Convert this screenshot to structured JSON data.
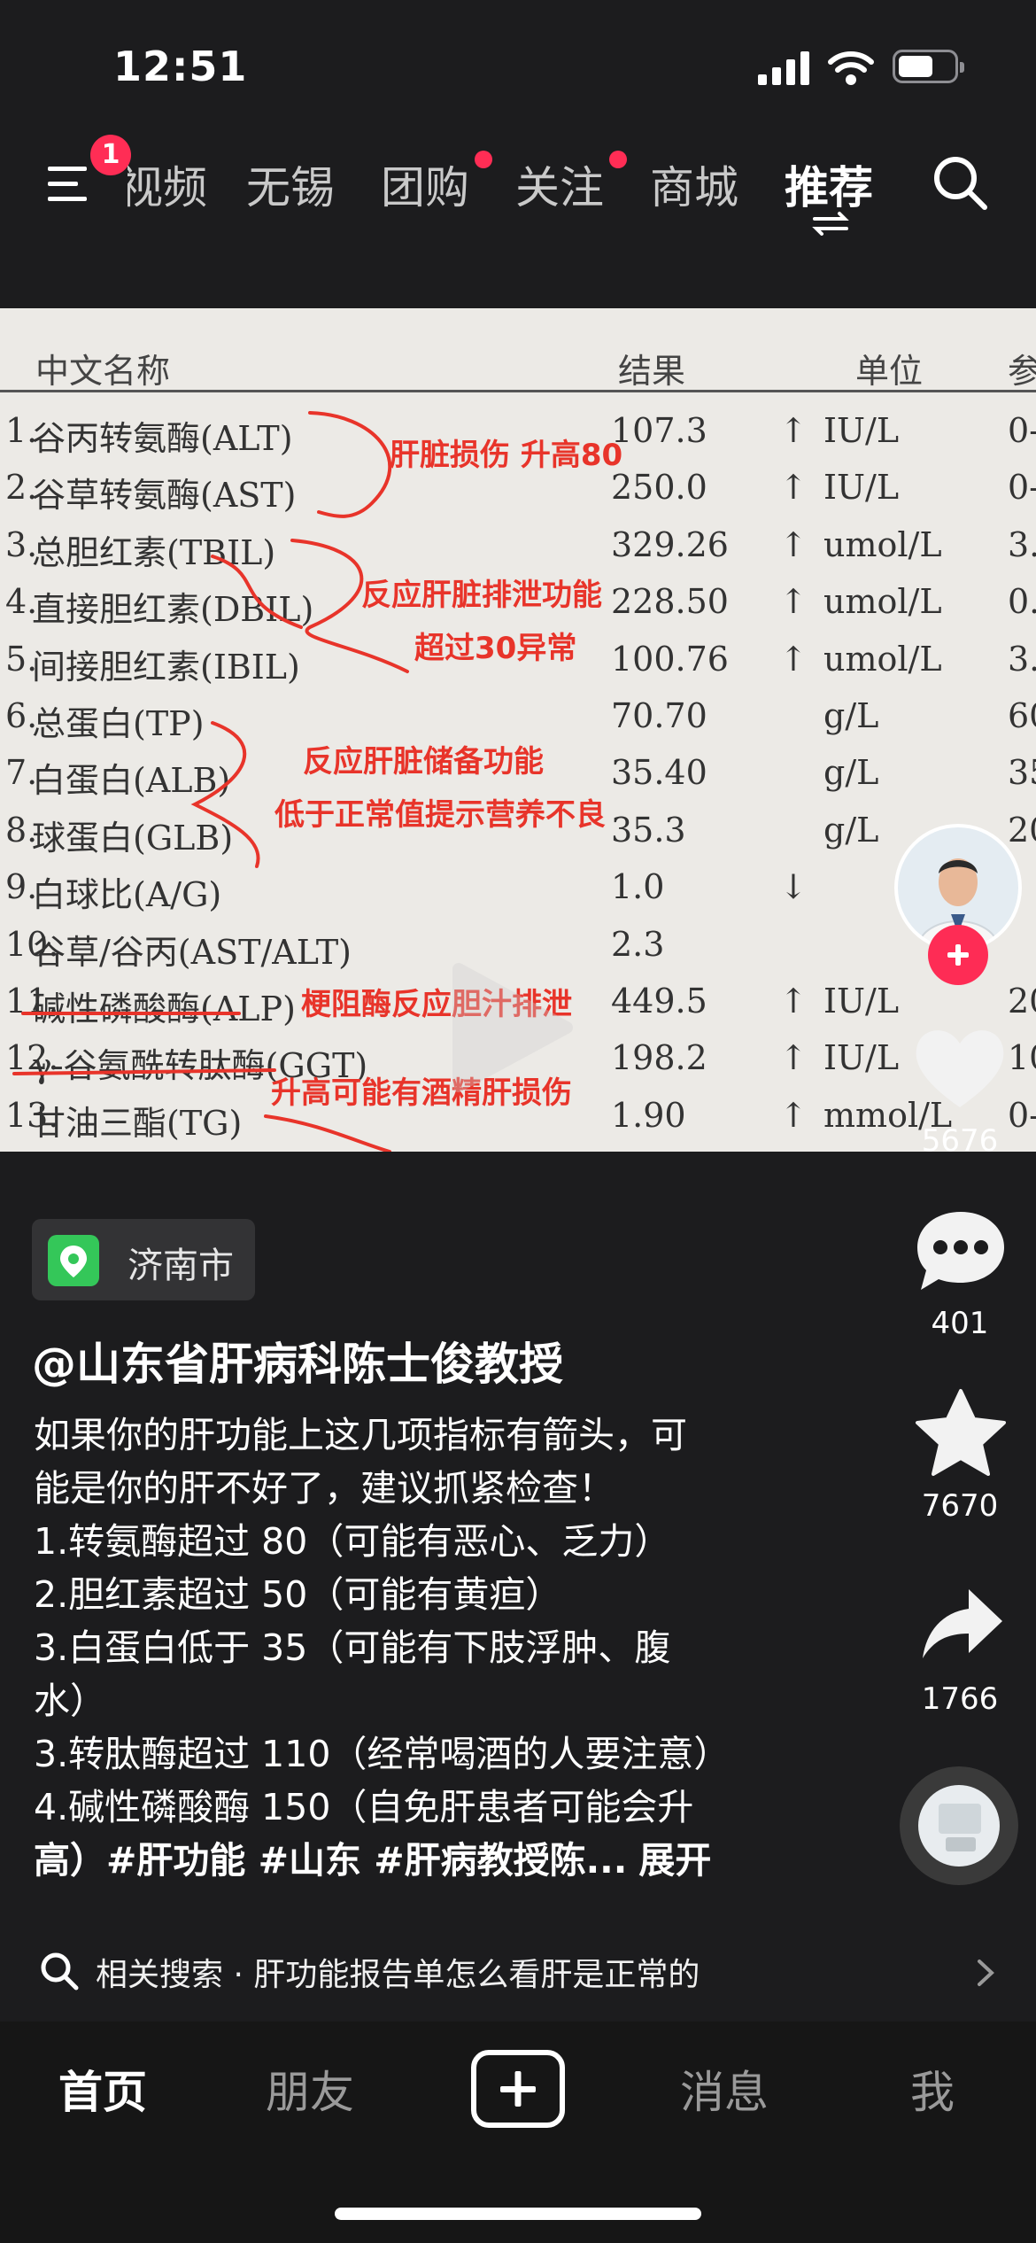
{
  "status": {
    "time": "12:51"
  },
  "top_nav": {
    "menu_badge": "1",
    "tabs": [
      {
        "label": "视频"
      },
      {
        "label": "无锡"
      },
      {
        "label": "团购"
      },
      {
        "label": "关注"
      },
      {
        "label": "商城"
      },
      {
        "label": "推荐"
      }
    ]
  },
  "report": {
    "headers": {
      "name": "中文名称",
      "result": "结果",
      "unit": "单位",
      "ref": "参"
    },
    "rows": [
      {
        "n": "1.",
        "name": "谷丙转氨酶(ALT)",
        "result": "107.3",
        "flag": "↑",
        "unit": "IU/L",
        "ref": "0-"
      },
      {
        "n": "2.",
        "name": "谷草转氨酶(AST)",
        "result": "250.0",
        "flag": "↑",
        "unit": "IU/L",
        "ref": "0-"
      },
      {
        "n": "3.",
        "name": "总胆红素(TBIL)",
        "result": "329.26",
        "flag": "↑",
        "unit": "umol/L",
        "ref": "3."
      },
      {
        "n": "4.",
        "name": "直接胆红素(DBIL)",
        "result": "228.50",
        "flag": "↑",
        "unit": "umol/L",
        "ref": "0."
      },
      {
        "n": "5.",
        "name": "间接胆红素(IBIL)",
        "result": "100.76",
        "flag": "↑",
        "unit": "umol/L",
        "ref": "3."
      },
      {
        "n": "6.",
        "name": "总蛋白(TP)",
        "result": "70.70",
        "flag": "",
        "unit": "g/L",
        "ref": "60"
      },
      {
        "n": "7.",
        "name": "白蛋白(ALB)",
        "result": "35.40",
        "flag": "",
        "unit": "g/L",
        "ref": "35"
      },
      {
        "n": "8.",
        "name": "球蛋白(GLB)",
        "result": "35.3",
        "flag": "",
        "unit": "g/L",
        "ref": "20"
      },
      {
        "n": "9.",
        "name": "白球比(A/G)",
        "result": "1.0",
        "flag": "↓",
        "unit": "",
        "ref": ""
      },
      {
        "n": "10.",
        "name": "谷草/谷丙(AST/ALT)",
        "result": "2.3",
        "flag": "",
        "unit": "",
        "ref": ""
      },
      {
        "n": "11.",
        "name": "碱性磷酸酶(ALP)",
        "result": "449.5",
        "flag": "↑",
        "unit": "IU/L",
        "ref": "20"
      },
      {
        "n": "12.",
        "name": "γ-谷氨酰转肽酶(GGT)",
        "result": "198.2",
        "flag": "↑",
        "unit": "IU/L",
        "ref": "10"
      },
      {
        "n": "13.",
        "name": "甘油三酯(TG)",
        "result": "1.90",
        "flag": "↑",
        "unit": "mmol/L",
        "ref": "0-"
      }
    ],
    "notes": {
      "n1": "肝脏损伤 升高80",
      "n2": "反应肝脏排泄功能",
      "n3": "超过30异常",
      "n4": "反应肝脏储备功能",
      "n5": "低于正常值提示营养不良",
      "n6": "梗阻酶反应胆汁排泄",
      "n7": "升高可能有酒精肝损伤"
    }
  },
  "rail": {
    "likes": "5676",
    "comments": "401",
    "favorites": "7670",
    "shares": "1766"
  },
  "post": {
    "location": "济南市",
    "author": "@山东省肝病科陈士俊教授",
    "lines": [
      "如果你的肝功能上这几项指标有箭头，可",
      "能是你的肝不好了，建议抓紧检查！",
      "1.转氨酶超过 80（可能有恶心、乏力）",
      "2.胆红素超过 50（可能有黄疸）",
      "3.白蛋白低于 35（可能有下肢浮肿、腹",
      "水）",
      "3.转肽酶超过 110（经常喝酒的人要注意）",
      "4.碱性磷酸酶 150（自免肝患者可能会升"
    ],
    "last_line": "高）#肝功能 #山东 #肝病教授陈...",
    "expand": "展开"
  },
  "related": {
    "prefix": "相关搜索",
    "dot": "·",
    "query": "肝功能报告单怎么看肝是正常的"
  },
  "bottom_nav": {
    "home": "首页",
    "friends": "朋友",
    "messages": "消息",
    "me": "我"
  }
}
